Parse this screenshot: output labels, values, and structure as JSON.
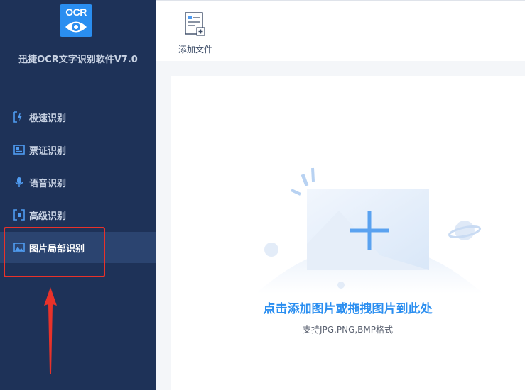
{
  "app": {
    "logo_text": "OCR",
    "title": "迅捷OCR文字识别软件V7.0"
  },
  "sidebar": {
    "items": [
      {
        "label": "极速识别",
        "icon": "lightning-scan-icon"
      },
      {
        "label": "票证识别",
        "icon": "ticket-card-icon"
      },
      {
        "label": "语音识别",
        "icon": "microphone-icon"
      },
      {
        "label": "高级识别",
        "icon": "bracket-scan-icon"
      },
      {
        "label": "图片局部识别",
        "icon": "image-region-icon",
        "active": true
      }
    ]
  },
  "toolbar": {
    "add_file_label": "添加文件"
  },
  "dropzone": {
    "title": "点击添加图片或拖拽图片到此处",
    "subtitle": "支持JPG,PNG,BMP格式"
  },
  "colors": {
    "sidebar_bg": "#1e3258",
    "active_item_bg": "#2b4470",
    "accent": "#2a8ef0",
    "annotation_red": "#e8322a"
  }
}
